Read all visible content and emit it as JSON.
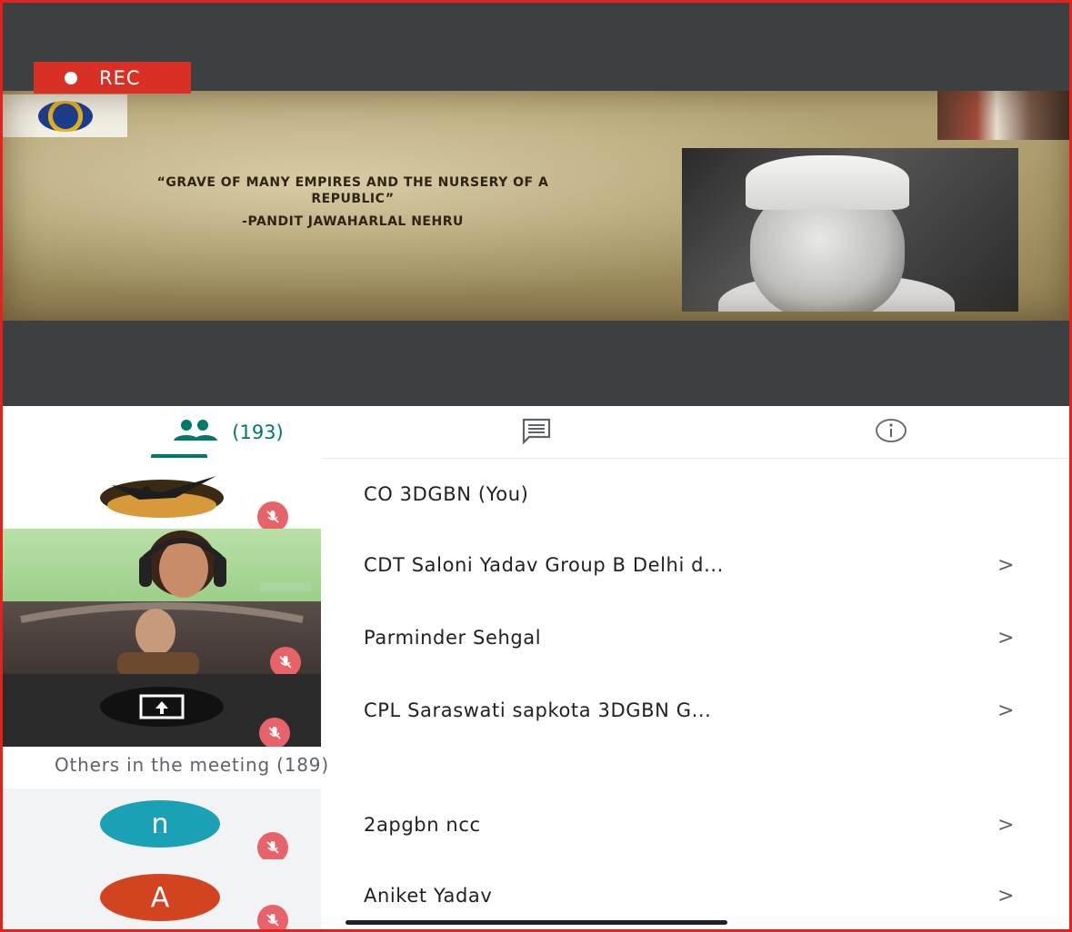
{
  "recording": {
    "label": "REC"
  },
  "slide": {
    "quote": "“GRAVE OF MANY EMPIRES AND THE NURSERY OF A REPUBLIC”",
    "author": "-PANDIT JAWAHARLAL NEHRU"
  },
  "tabs": {
    "people_count": "(193)",
    "people_icon": "people-icon",
    "chat_icon": "chat-icon",
    "info_icon": "info-icon",
    "accent": "#00796b"
  },
  "participants": [
    {
      "name": "CO 3DGBN (You)",
      "muted": true,
      "has_chevron": false
    },
    {
      "name": "CDT Saloni Yadav Group B Delhi d...",
      "muted": false,
      "has_chevron": true
    },
    {
      "name": "Parminder Sehgal",
      "muted": true,
      "has_chevron": true
    },
    {
      "name": "CPL Saraswati sapkota 3DGBN G...",
      "muted": true,
      "has_chevron": true
    }
  ],
  "others": {
    "label": "Others in the meeting (189)",
    "people": [
      {
        "name": "2apgbn ncc",
        "initial": "n",
        "avatar_color": "#1ba1b5",
        "muted": true
      },
      {
        "name": "Aniket Yadav",
        "initial": "A",
        "avatar_color": "#d2431f",
        "muted": true
      }
    ]
  },
  "chevron": ">",
  "colors": {
    "mute": "#e8626a",
    "rec": "#d93025",
    "frame": "#e0231c"
  }
}
